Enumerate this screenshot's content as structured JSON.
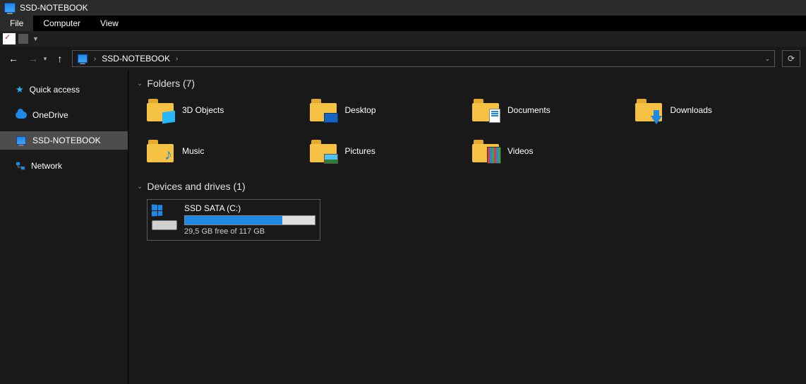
{
  "window": {
    "title": "SSD-NOTEBOOK"
  },
  "menu": {
    "file": "File",
    "computer": "Computer",
    "view": "View"
  },
  "breadcrumb": {
    "root": "SSD-NOTEBOOK"
  },
  "sidebar": {
    "quick_access": "Quick access",
    "onedrive": "OneDrive",
    "this_pc": "SSD-NOTEBOOK",
    "network": "Network"
  },
  "sections": {
    "folders_label": "Folders (7)",
    "drives_label": "Devices and drives (1)"
  },
  "folders": {
    "objects3d": "3D Objects",
    "desktop": "Desktop",
    "documents": "Documents",
    "downloads": "Downloads",
    "music": "Music",
    "pictures": "Pictures",
    "videos": "Videos"
  },
  "drive": {
    "name": "SSD SATA (C:)",
    "free_text": "29,5 GB free of 117 GB",
    "used_percent": 75
  }
}
